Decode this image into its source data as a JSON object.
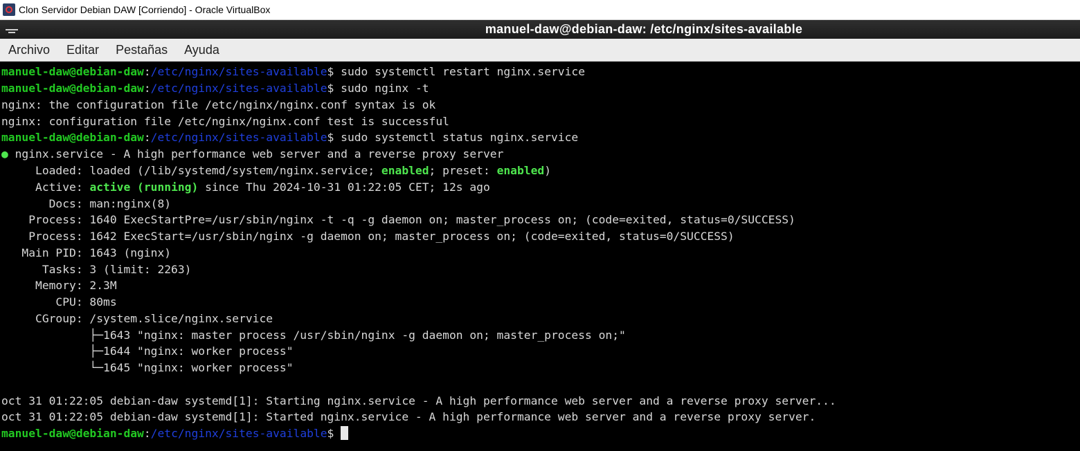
{
  "window": {
    "title": "Clon Servidor Debian DAW [Corriendo] - Oracle VirtualBox"
  },
  "terminal_window": {
    "title": "manuel-daw@debian-daw: /etc/nginx/sites-available"
  },
  "menubar": {
    "items": [
      "Archivo",
      "Editar",
      "Pestañas",
      "Ayuda"
    ]
  },
  "prompt": {
    "user": "manuel-daw@debian-daw",
    "sep": ":",
    "path": "/etc/nginx/sites-available",
    "symbol": "$ "
  },
  "terminal": {
    "cmd1": "sudo systemctl restart nginx.service",
    "cmd2": "sudo nginx -t",
    "out1": "nginx: the configuration file /etc/nginx/nginx.conf syntax is ok",
    "out2": "nginx: configuration file /etc/nginx/nginx.conf test is successful",
    "cmd3": "sudo systemctl status nginx.service",
    "service_dot": "●",
    "service_line": " nginx.service - A high performance web server and a reverse proxy server",
    "loaded_pre": "     Loaded: loaded (/lib/systemd/system/nginx.service; ",
    "loaded_enabled": "enabled",
    "loaded_mid": "; preset: ",
    "loaded_preset": "enabled",
    "loaded_end": ")",
    "active_pre": "     Active: ",
    "active_state": "active (running)",
    "active_post": " since Thu 2024-10-31 01:22:05 CET; 12s ago",
    "docs": "       Docs: man:nginx(8)",
    "process1": "    Process: 1640 ExecStartPre=/usr/sbin/nginx -t -q -g daemon on; master_process on; (code=exited, status=0/SUCCESS)",
    "process2": "    Process: 1642 ExecStart=/usr/sbin/nginx -g daemon on; master_process on; (code=exited, status=0/SUCCESS)",
    "mainpid": "   Main PID: 1643 (nginx)",
    "tasks": "      Tasks: 3 (limit: 2263)",
    "memory": "     Memory: 2.3M",
    "cpu": "        CPU: 80ms",
    "cgroup": "     CGroup: /system.slice/nginx.service",
    "cg1": "             ├─1643 \"nginx: master process /usr/sbin/nginx -g daemon on; master_process on;\"",
    "cg2": "             ├─1644 \"nginx: worker process\"",
    "cg3": "             └─1645 \"nginx: worker process\"",
    "log1": "oct 31 01:22:05 debian-daw systemd[1]: Starting nginx.service - A high performance web server and a reverse proxy server...",
    "log2": "oct 31 01:22:05 debian-daw systemd[1]: Started nginx.service - A high performance web server and a reverse proxy server."
  },
  "colors": {
    "prompt_user": "#22c922",
    "prompt_path": "#1f3fdc",
    "status_green": "#4ee64e",
    "terminal_bg": "#000000",
    "terminal_fg": "#d8d8d8"
  }
}
